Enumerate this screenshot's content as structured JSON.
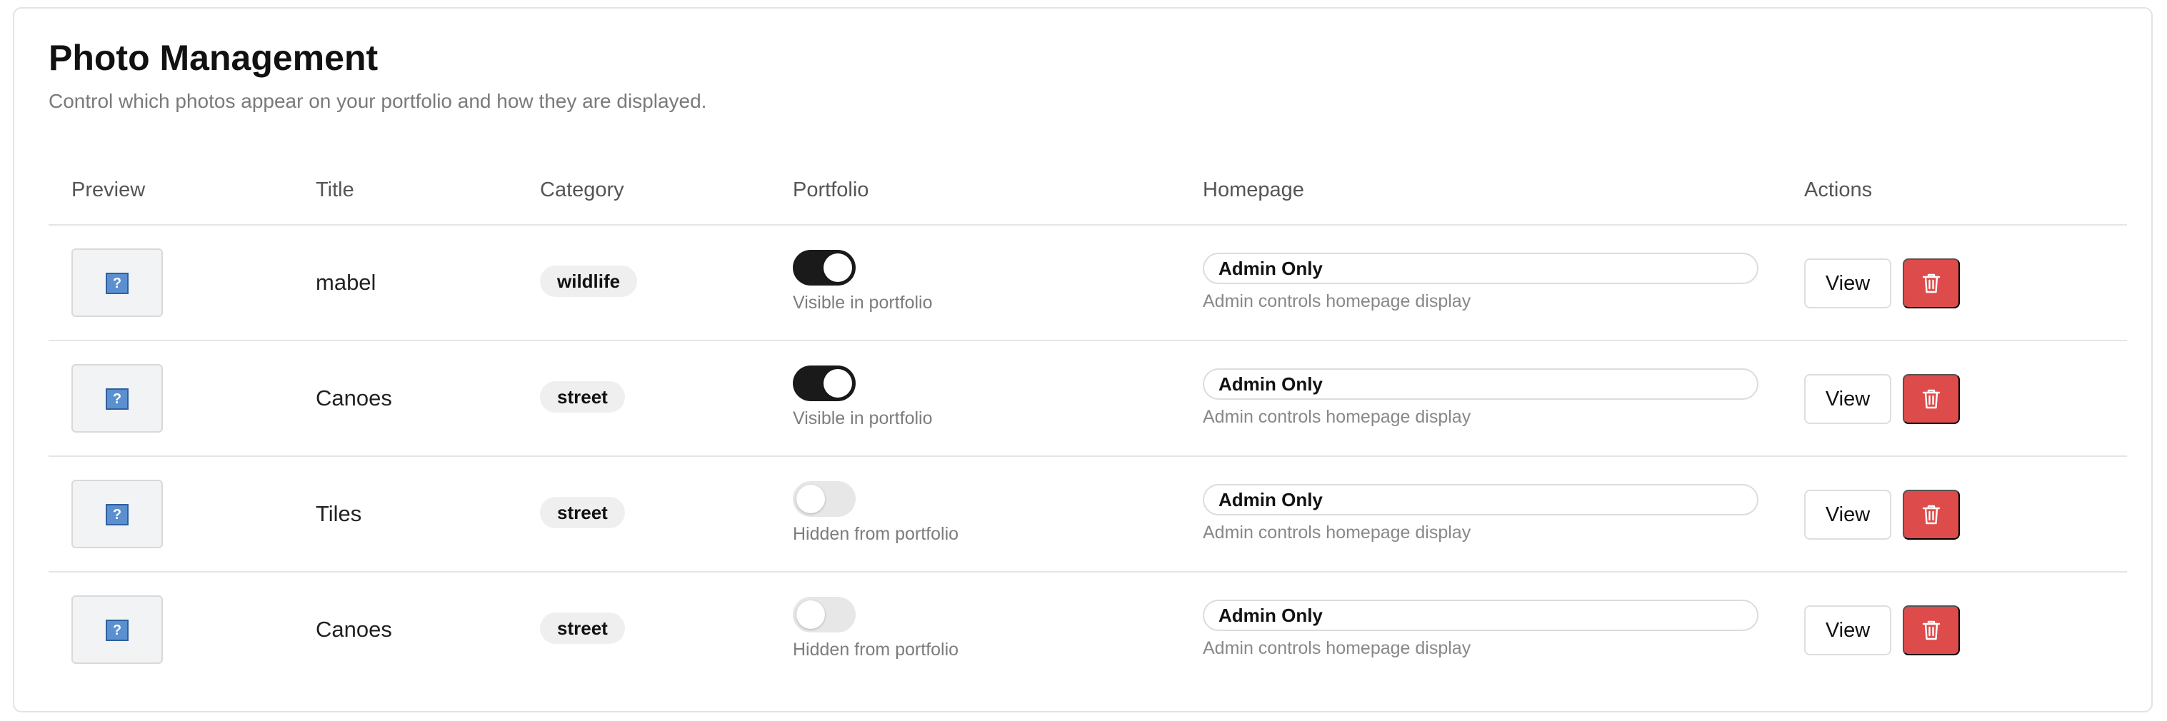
{
  "header": {
    "title": "Photo Management",
    "subtitle": "Control which photos appear on your portfolio and how they are displayed."
  },
  "table": {
    "columns": [
      "Preview",
      "Title",
      "Category",
      "Portfolio",
      "Homepage",
      "Actions"
    ],
    "rows": [
      {
        "preview_icon": "?",
        "title": "mabel",
        "category": "wildlife",
        "portfolio_on": true,
        "portfolio_text": "Visible in portfolio",
        "homepage_value": "Admin Only",
        "homepage_help": "Admin controls homepage display",
        "view_label": "View"
      },
      {
        "preview_icon": "?",
        "title": "Canoes",
        "category": "street",
        "portfolio_on": true,
        "portfolio_text": "Visible in portfolio",
        "homepage_value": "Admin Only",
        "homepage_help": "Admin controls homepage display",
        "view_label": "View"
      },
      {
        "preview_icon": "?",
        "title": "Tiles",
        "category": "street",
        "portfolio_on": false,
        "portfolio_text": "Hidden from portfolio",
        "homepage_value": "Admin Only",
        "homepage_help": "Admin controls homepage display",
        "view_label": "View"
      },
      {
        "preview_icon": "?",
        "title": "Canoes",
        "category": "street",
        "portfolio_on": false,
        "portfolio_text": "Hidden from portfolio",
        "homepage_value": "Admin Only",
        "homepage_help": "Admin controls homepage display",
        "view_label": "View"
      }
    ]
  },
  "colors": {
    "toggle_on": "#1a1a1a",
    "toggle_off": "#e7e7e7",
    "delete_button": "#de4b4b",
    "badge_bg": "#efefef"
  },
  "icons": {
    "preview": "image-placeholder-icon",
    "delete": "trash-icon"
  }
}
